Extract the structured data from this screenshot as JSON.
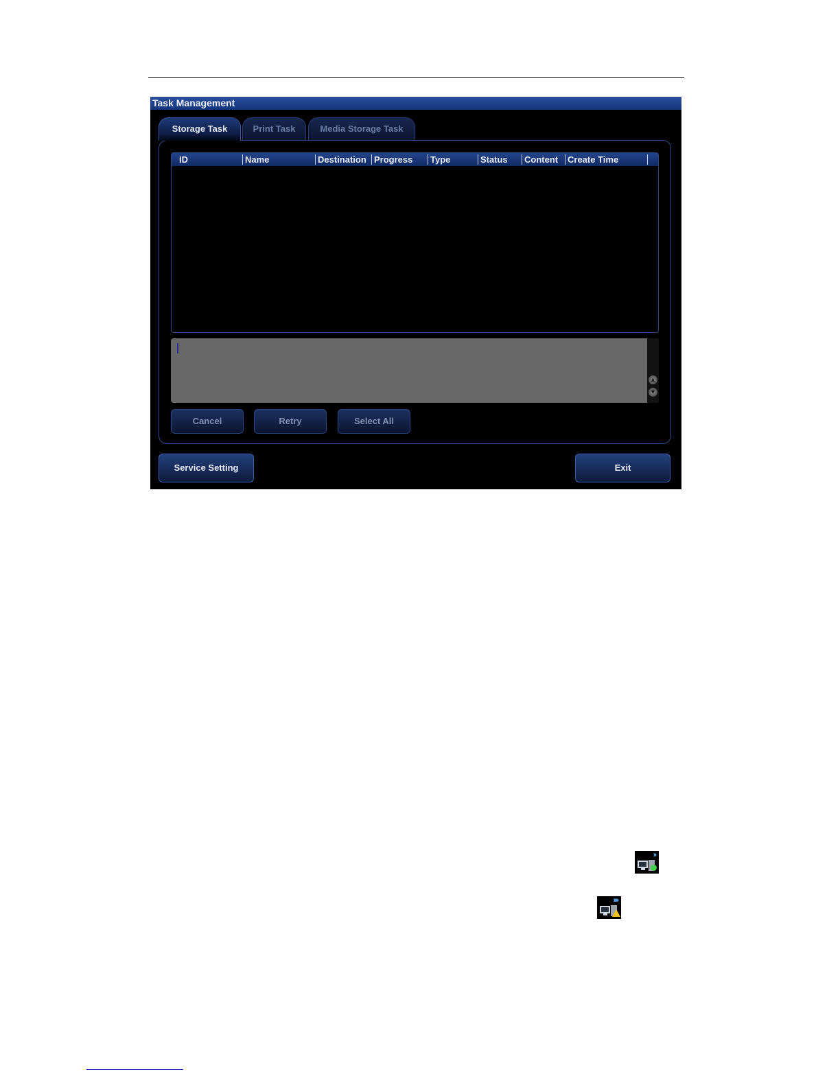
{
  "dialog": {
    "title": "Task Management",
    "tabs": [
      {
        "label": "Storage Task",
        "active": true
      },
      {
        "label": "Print Task",
        "active": false
      },
      {
        "label": "Media Storage Task",
        "active": false
      }
    ],
    "table": {
      "columns": [
        "ID",
        "Name",
        "Destination",
        "Progress",
        "Type",
        "Status",
        "Content",
        "Create Time"
      ],
      "rows": []
    },
    "log_text": "",
    "buttons": {
      "cancel": "Cancel",
      "retry": "Retry",
      "select_all": "Select All",
      "service_setting": "Service Setting",
      "exit": "Exit"
    }
  },
  "icons": [
    {
      "name": "network-transfer-ok-icon",
      "status": "green"
    },
    {
      "name": "network-transfer-warning-icon",
      "status": "yellow"
    }
  ],
  "colors": {
    "titlebar": "#1f4390",
    "background": "#000000",
    "accent": "#2c4a8c",
    "log_area": "#686868"
  }
}
